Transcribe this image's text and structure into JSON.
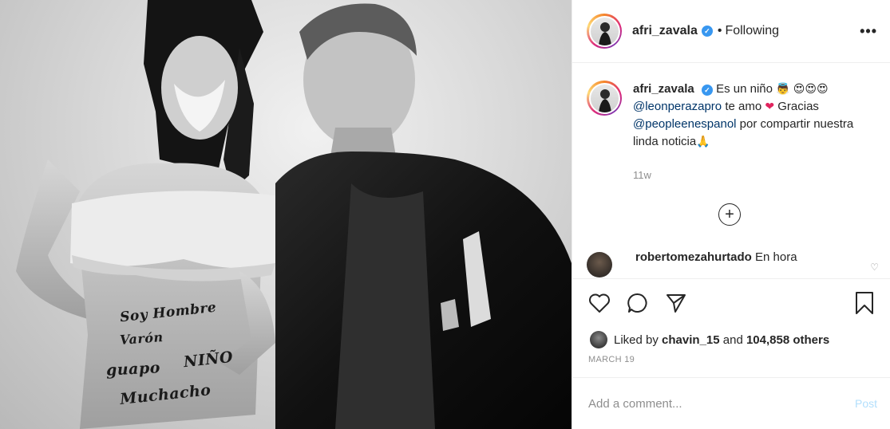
{
  "post": {
    "author": {
      "username": "afri_zavala",
      "verified_icon": "verified-badge-icon",
      "separator": "•",
      "follow_status": "Following"
    },
    "menu_icon": "more-options-icon",
    "menu_label": "•••",
    "photo": {
      "belly_text": [
        "Soy Hombre",
        "Varón",
        "guapo",
        "NIÑO",
        "Muchacho"
      ]
    },
    "caption": {
      "username": "afri_zavala",
      "text_1": "Es un niño",
      "emoji_1": "👼",
      "emoji_2": "😍😍😍",
      "mention_1": "@leonperazapro",
      "text_2": "te amo",
      "emoji_heart": "❤",
      "text_3": "Gracias",
      "mention_2": "@peopleenespanol",
      "text_4": "por compartir nuestra linda noticia",
      "emoji_pray": "🙏",
      "time_ago": "11w"
    },
    "load_more_label": "+",
    "comments": [
      {
        "username": "robertomezahurtado",
        "text": "En hora"
      }
    ],
    "actions": {
      "like": "heart-icon",
      "comment": "comment-bubble-icon",
      "share": "paper-plane-icon",
      "save": "bookmark-icon"
    },
    "likes": {
      "prefix": "Liked by",
      "first_liker": "chavin_15",
      "and": "and",
      "others": "104,858 others"
    },
    "date": "MARCH 19",
    "add_comment": {
      "placeholder": "Add a comment...",
      "post_label": "Post"
    },
    "colors": {
      "link": "#003569",
      "verified": "#3897f0",
      "muted": "#8e8e8e",
      "post_disabled": "#b2dffc"
    }
  }
}
